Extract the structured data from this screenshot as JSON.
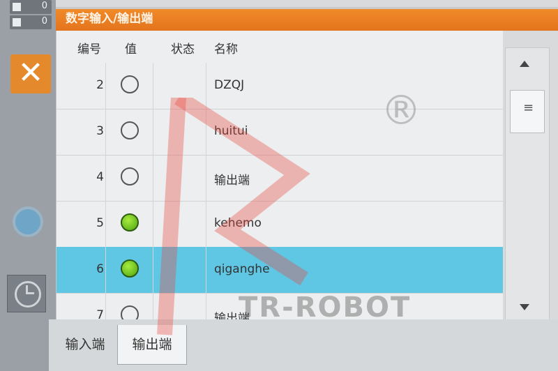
{
  "sidebar": {
    "fields": [
      {
        "value": "0"
      },
      {
        "value": "0"
      }
    ],
    "close_label": "✕"
  },
  "panel": {
    "title": "数字输入/输出端",
    "headers": {
      "number": "编号",
      "value": "值",
      "status": "状态",
      "name": "名称"
    },
    "rows": [
      {
        "number": "2",
        "on": false,
        "name": "DZQJ"
      },
      {
        "number": "3",
        "on": false,
        "name": "huitui"
      },
      {
        "number": "4",
        "on": false,
        "name": "输出端"
      },
      {
        "number": "5",
        "on": true,
        "name": "kehemo"
      },
      {
        "number": "6",
        "on": true,
        "name": "qiganghe",
        "selected": true
      },
      {
        "number": "7",
        "on": false,
        "name": "输出端"
      }
    ]
  },
  "scrollbar": {
    "thumb_glyph": "≡"
  },
  "tabs": [
    {
      "label": "输入端",
      "active": false
    },
    {
      "label": "输出端",
      "active": true
    }
  ],
  "watermark": {
    "brand": "TR-ROBOT",
    "reg": "®"
  },
  "colors": {
    "accent": "#e4741c",
    "selected_row": "#5fc6e3",
    "led_on": "#4da410"
  }
}
